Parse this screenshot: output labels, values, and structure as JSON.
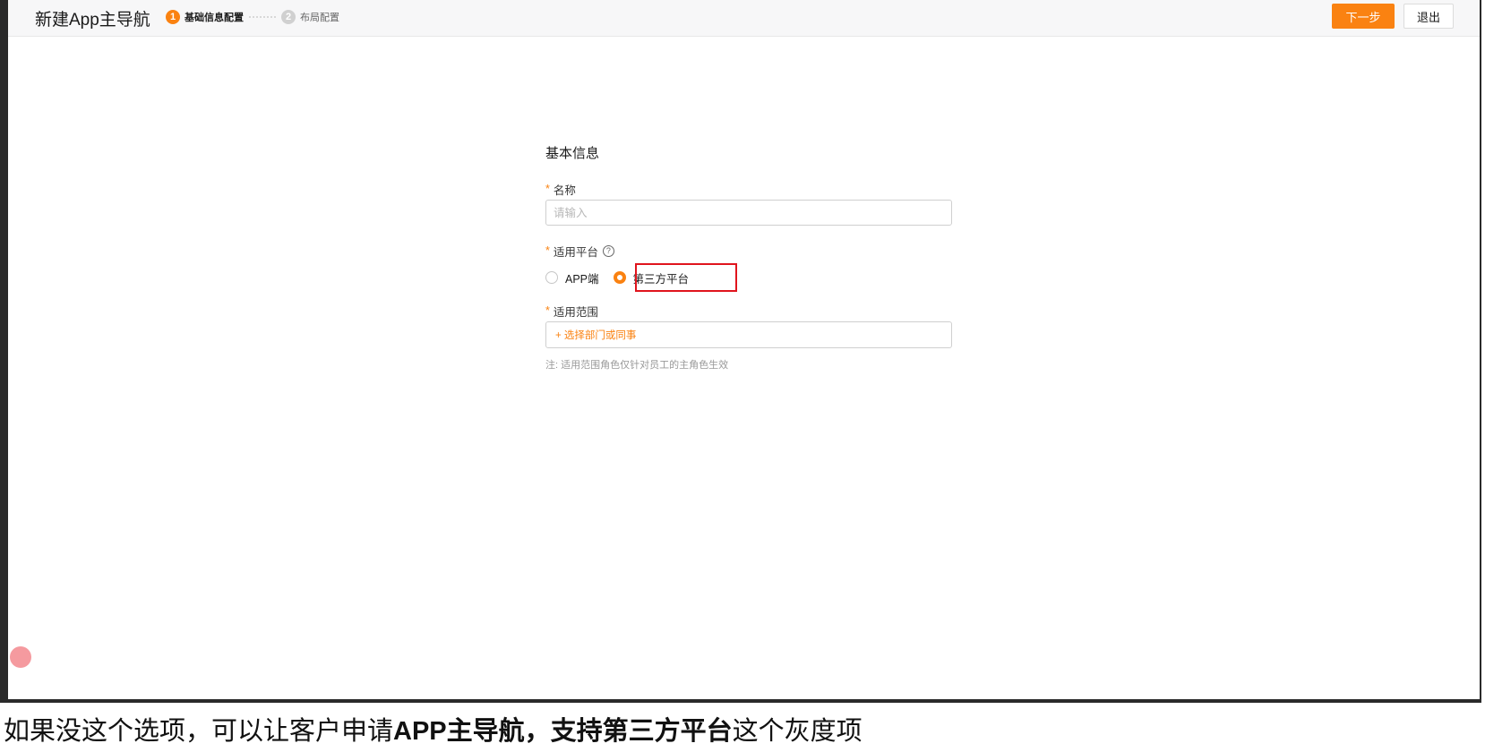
{
  "header": {
    "title": "新建App主导航",
    "steps": [
      {
        "number": "1",
        "label": "基础信息配置"
      },
      {
        "number": "2",
        "label": "布局配置"
      }
    ],
    "next_label": "下一步",
    "exit_label": "退出"
  },
  "form": {
    "section_title": "基本信息",
    "required_mark": "*",
    "name": {
      "label": "名称",
      "placeholder": "请输入"
    },
    "platform": {
      "label": "适用平台",
      "help_glyph": "?",
      "options": [
        {
          "label": "APP端",
          "checked": false
        },
        {
          "label": "第三方平台",
          "checked": true
        }
      ]
    },
    "scope": {
      "label": "适用范围",
      "add_label": "+ 选择部门或同事"
    },
    "note": "注: 适用范围角色仅针对员工的主角色生效"
  },
  "caption": {
    "part1": "如果没这个选项，可以让客户申请",
    "bold1": "APP主导航，支持第三方平台",
    "part2": "这个灰度项"
  },
  "colors": {
    "accent": "#fa8211",
    "highlight": "#e0141d"
  }
}
